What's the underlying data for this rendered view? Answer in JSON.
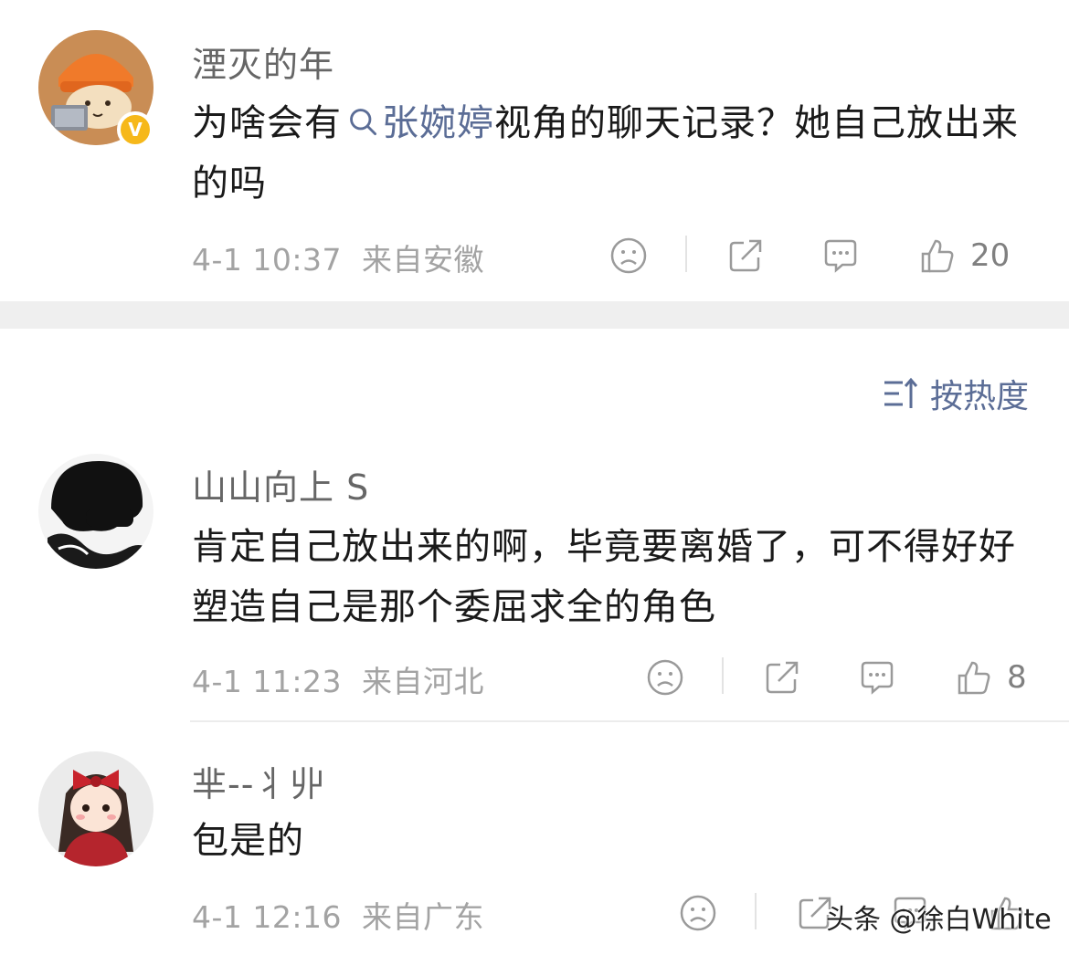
{
  "comments": [
    {
      "username": "湮灭的年",
      "text_before": "为啥会有",
      "mention": "张婉婷",
      "text_after": "视角的聊天记录？她自己放出来的吗",
      "time": "4-1 10:37",
      "location": "来自安徽",
      "likes": "20",
      "verified_badge": "V",
      "avatar_icon": "orange-hat-character-avatar"
    },
    {
      "username": "山山向上 S",
      "text": "肯定自己放出来的啊，毕竟要离婚了，可不得好好塑造自己是那个委屈求全的角色",
      "time": "4-1 11:23",
      "location": "来自河北",
      "likes": "8",
      "avatar_icon": "black-silhouette-avatar"
    },
    {
      "username": "芈--丬丱",
      "text": "包是的",
      "time": "4-1 12:16",
      "location": "来自广东",
      "likes": "",
      "avatar_icon": "girl-red-bow-avatar"
    }
  ],
  "sort": {
    "label": "按热度",
    "icon": "sort-icon"
  },
  "watermark": "头条 @徐白White",
  "colors": {
    "link": "#5b6d96",
    "meta": "#a3a3a3",
    "badge": "#f6b81a",
    "gap": "#efefef"
  }
}
